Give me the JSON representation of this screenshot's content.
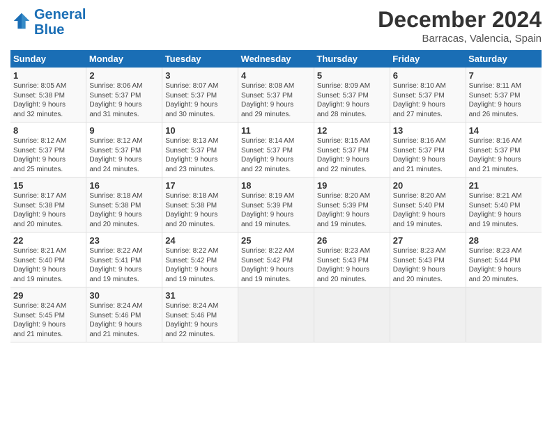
{
  "header": {
    "logo_line1": "General",
    "logo_line2": "Blue",
    "title": "December 2024",
    "subtitle": "Barracas, Valencia, Spain"
  },
  "weekdays": [
    "Sunday",
    "Monday",
    "Tuesday",
    "Wednesday",
    "Thursday",
    "Friday",
    "Saturday"
  ],
  "weeks": [
    [
      {
        "day": "1",
        "info": "Sunrise: 8:05 AM\nSunset: 5:38 PM\nDaylight: 9 hours\nand 32 minutes."
      },
      {
        "day": "2",
        "info": "Sunrise: 8:06 AM\nSunset: 5:37 PM\nDaylight: 9 hours\nand 31 minutes."
      },
      {
        "day": "3",
        "info": "Sunrise: 8:07 AM\nSunset: 5:37 PM\nDaylight: 9 hours\nand 30 minutes."
      },
      {
        "day": "4",
        "info": "Sunrise: 8:08 AM\nSunset: 5:37 PM\nDaylight: 9 hours\nand 29 minutes."
      },
      {
        "day": "5",
        "info": "Sunrise: 8:09 AM\nSunset: 5:37 PM\nDaylight: 9 hours\nand 28 minutes."
      },
      {
        "day": "6",
        "info": "Sunrise: 8:10 AM\nSunset: 5:37 PM\nDaylight: 9 hours\nand 27 minutes."
      },
      {
        "day": "7",
        "info": "Sunrise: 8:11 AM\nSunset: 5:37 PM\nDaylight: 9 hours\nand 26 minutes."
      }
    ],
    [
      {
        "day": "8",
        "info": "Sunrise: 8:12 AM\nSunset: 5:37 PM\nDaylight: 9 hours\nand 25 minutes."
      },
      {
        "day": "9",
        "info": "Sunrise: 8:12 AM\nSunset: 5:37 PM\nDaylight: 9 hours\nand 24 minutes."
      },
      {
        "day": "10",
        "info": "Sunrise: 8:13 AM\nSunset: 5:37 PM\nDaylight: 9 hours\nand 23 minutes."
      },
      {
        "day": "11",
        "info": "Sunrise: 8:14 AM\nSunset: 5:37 PM\nDaylight: 9 hours\nand 22 minutes."
      },
      {
        "day": "12",
        "info": "Sunrise: 8:15 AM\nSunset: 5:37 PM\nDaylight: 9 hours\nand 22 minutes."
      },
      {
        "day": "13",
        "info": "Sunrise: 8:16 AM\nSunset: 5:37 PM\nDaylight: 9 hours\nand 21 minutes."
      },
      {
        "day": "14",
        "info": "Sunrise: 8:16 AM\nSunset: 5:37 PM\nDaylight: 9 hours\nand 21 minutes."
      }
    ],
    [
      {
        "day": "15",
        "info": "Sunrise: 8:17 AM\nSunset: 5:38 PM\nDaylight: 9 hours\nand 20 minutes."
      },
      {
        "day": "16",
        "info": "Sunrise: 8:18 AM\nSunset: 5:38 PM\nDaylight: 9 hours\nand 20 minutes."
      },
      {
        "day": "17",
        "info": "Sunrise: 8:18 AM\nSunset: 5:38 PM\nDaylight: 9 hours\nand 20 minutes."
      },
      {
        "day": "18",
        "info": "Sunrise: 8:19 AM\nSunset: 5:39 PM\nDaylight: 9 hours\nand 19 minutes."
      },
      {
        "day": "19",
        "info": "Sunrise: 8:20 AM\nSunset: 5:39 PM\nDaylight: 9 hours\nand 19 minutes."
      },
      {
        "day": "20",
        "info": "Sunrise: 8:20 AM\nSunset: 5:40 PM\nDaylight: 9 hours\nand 19 minutes."
      },
      {
        "day": "21",
        "info": "Sunrise: 8:21 AM\nSunset: 5:40 PM\nDaylight: 9 hours\nand 19 minutes."
      }
    ],
    [
      {
        "day": "22",
        "info": "Sunrise: 8:21 AM\nSunset: 5:40 PM\nDaylight: 9 hours\nand 19 minutes."
      },
      {
        "day": "23",
        "info": "Sunrise: 8:22 AM\nSunset: 5:41 PM\nDaylight: 9 hours\nand 19 minutes."
      },
      {
        "day": "24",
        "info": "Sunrise: 8:22 AM\nSunset: 5:42 PM\nDaylight: 9 hours\nand 19 minutes."
      },
      {
        "day": "25",
        "info": "Sunrise: 8:22 AM\nSunset: 5:42 PM\nDaylight: 9 hours\nand 19 minutes."
      },
      {
        "day": "26",
        "info": "Sunrise: 8:23 AM\nSunset: 5:43 PM\nDaylight: 9 hours\nand 20 minutes."
      },
      {
        "day": "27",
        "info": "Sunrise: 8:23 AM\nSunset: 5:43 PM\nDaylight: 9 hours\nand 20 minutes."
      },
      {
        "day": "28",
        "info": "Sunrise: 8:23 AM\nSunset: 5:44 PM\nDaylight: 9 hours\nand 20 minutes."
      }
    ],
    [
      {
        "day": "29",
        "info": "Sunrise: 8:24 AM\nSunset: 5:45 PM\nDaylight: 9 hours\nand 21 minutes."
      },
      {
        "day": "30",
        "info": "Sunrise: 8:24 AM\nSunset: 5:46 PM\nDaylight: 9 hours\nand 21 minutes."
      },
      {
        "day": "31",
        "info": "Sunrise: 8:24 AM\nSunset: 5:46 PM\nDaylight: 9 hours\nand 22 minutes."
      },
      null,
      null,
      null,
      null
    ]
  ]
}
